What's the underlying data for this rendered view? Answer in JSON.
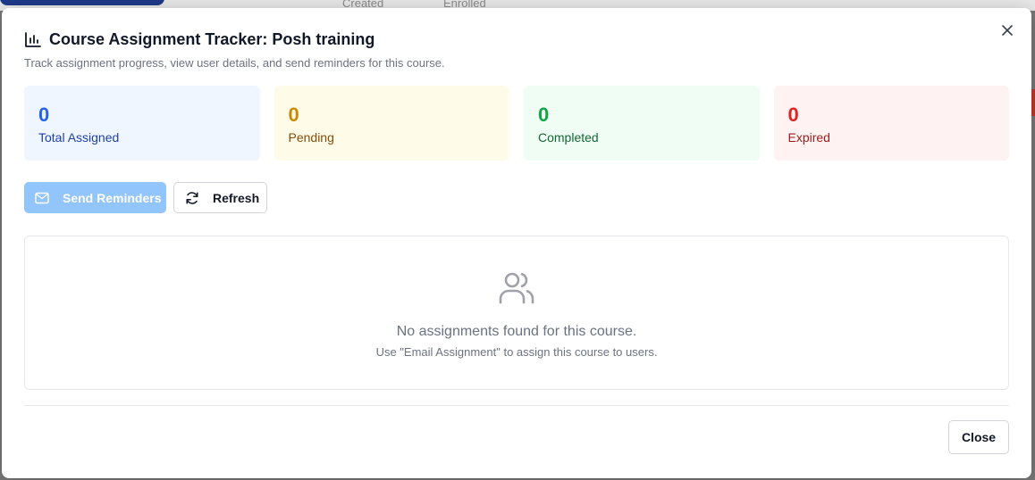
{
  "background": {
    "columns": [
      "Created",
      "Enrolled"
    ]
  },
  "dialog": {
    "title": "Course Assignment Tracker: Posh training",
    "subtitle": "Track assignment progress, view user details, and send reminders for this course.",
    "title_icon": "bar-chart-icon",
    "close_icon": "close-icon"
  },
  "stats": [
    {
      "value": "0",
      "label": "Total Assigned",
      "bg": "#eff6ff",
      "num_color": "#2563eb",
      "label_color": "#1e40af"
    },
    {
      "value": "0",
      "label": "Pending",
      "bg": "#fefce8",
      "num_color": "#ca8a04",
      "label_color": "#854d0e"
    },
    {
      "value": "0",
      "label": "Completed",
      "bg": "#f0fdf4",
      "num_color": "#16a34a",
      "label_color": "#166534"
    },
    {
      "value": "0",
      "label": "Expired",
      "bg": "#fef2f2",
      "num_color": "#dc2626",
      "label_color": "#991b1b"
    }
  ],
  "actions": {
    "send_reminders": "Send Reminders",
    "send_icon": "mail-icon",
    "refresh": "Refresh",
    "refresh_icon": "refresh-icon"
  },
  "empty_state": {
    "icon": "users-icon",
    "message": "No assignments found for this course.",
    "hint": "Use \"Email Assignment\" to assign this course to users."
  },
  "footer": {
    "close_label": "Close"
  }
}
